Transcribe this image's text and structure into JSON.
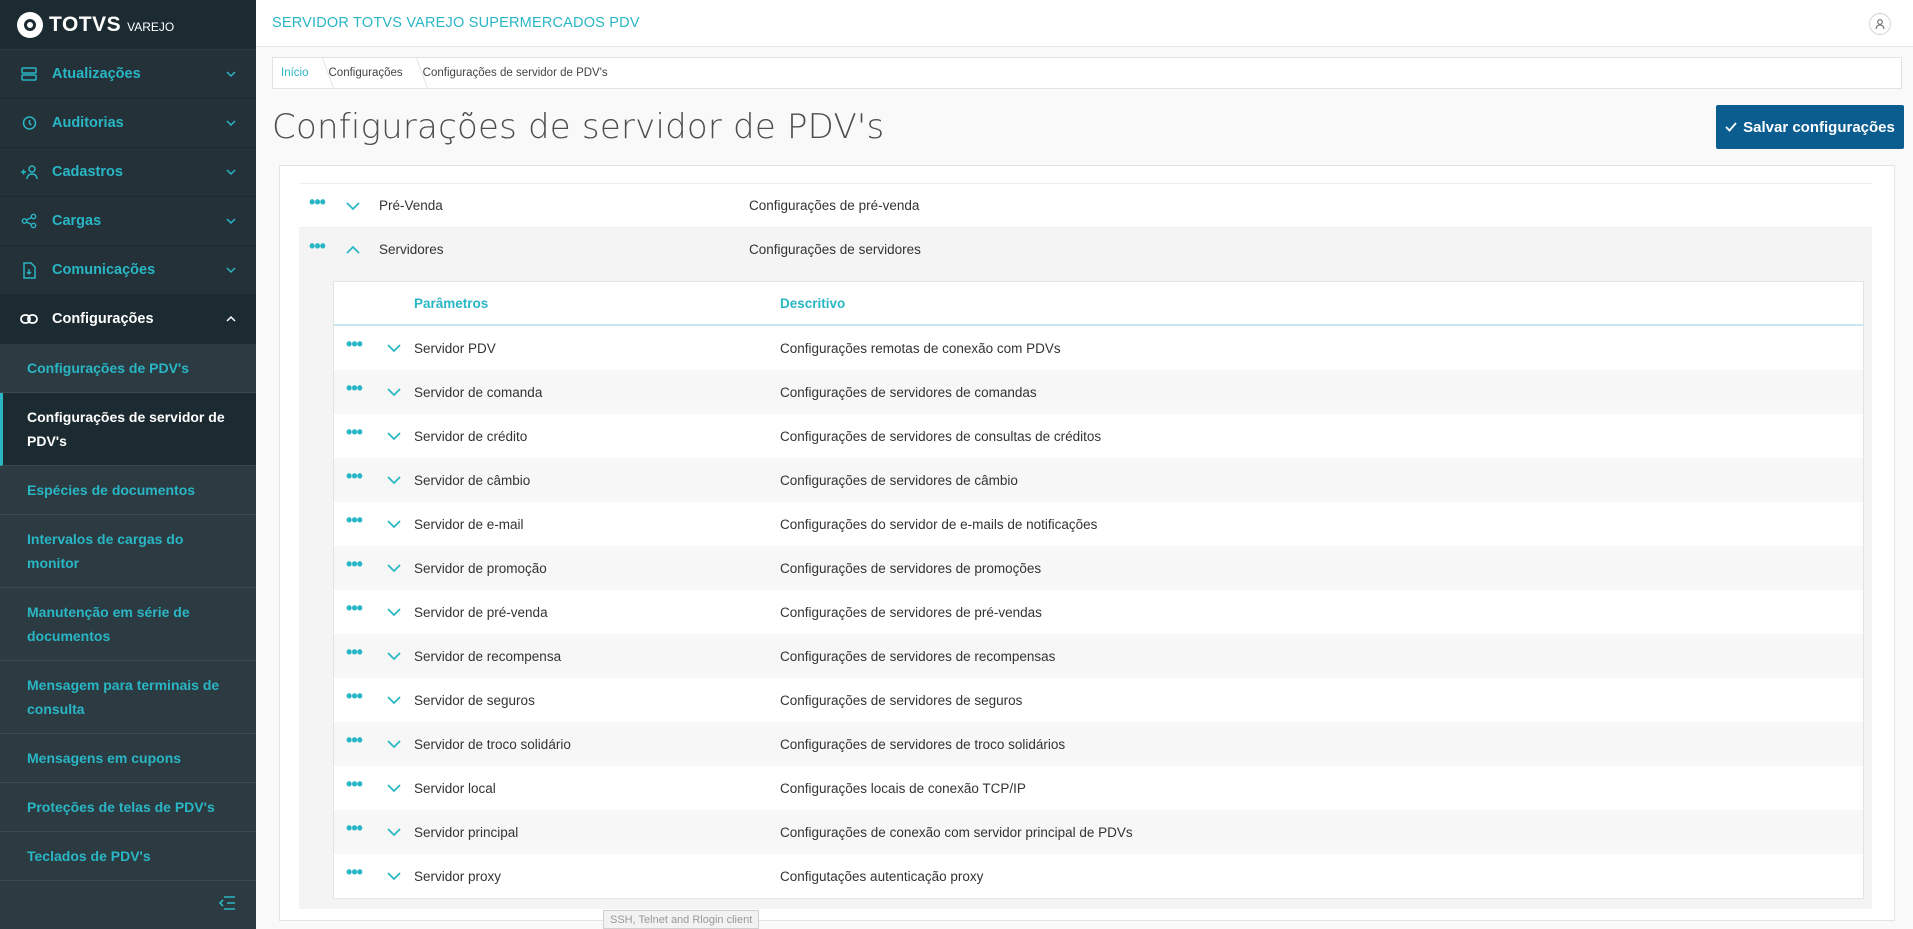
{
  "brand": {
    "name": "TOTVS",
    "sub": "VAREJO"
  },
  "sidebar": {
    "menu": [
      {
        "label": "Atualizações",
        "icon": "server-icon"
      },
      {
        "label": "Auditorias",
        "icon": "history-icon"
      },
      {
        "label": "Cadastros",
        "icon": "add-user-icon"
      },
      {
        "label": "Cargas",
        "icon": "share-icon"
      },
      {
        "label": "Comunicações",
        "icon": "document-sync-icon"
      },
      {
        "label": "Configurações",
        "icon": "link-icon"
      }
    ],
    "submenu": [
      "Configurações de PDV's",
      "Configurações de servidor de PDV's",
      "Espécies de documentos",
      "Intervalos de cargas do monitor",
      "Manutenção em série de documentos",
      "Mensagem para terminais de consulta",
      "Mensagens em cupons",
      "Proteções de telas de PDV's",
      "Teclados de PDV's"
    ]
  },
  "header": {
    "title": "SERVIDOR TOTVS VAREJO SUPERMERCADOS PDV"
  },
  "breadcrumb": [
    "Início",
    "Configurações",
    "Configurações de servidor de PDV's"
  ],
  "page": {
    "title": "Configurações de servidor de PDV's",
    "save_label": "Salvar configurações"
  },
  "outer_rows": [
    {
      "name": "Pré-Venda",
      "desc": "Configurações de pré-venda"
    },
    {
      "name": "Servidores",
      "desc": "Configurações de servidores"
    }
  ],
  "inner_table": {
    "headers": {
      "param": "Parâmetros",
      "desc": "Descritivo"
    },
    "rows": [
      {
        "param": "Servidor PDV",
        "desc": "Configurações remotas de conexão com PDVs"
      },
      {
        "param": "Servidor de comanda",
        "desc": "Configurações de servidores de comandas"
      },
      {
        "param": "Servidor de crédito",
        "desc": "Configurações de servidores de consultas de créditos"
      },
      {
        "param": "Servidor de câmbio",
        "desc": "Configurações de servidores de câmbio"
      },
      {
        "param": "Servidor de e-mail",
        "desc": "Configurações do servidor de e-mails de notificações"
      },
      {
        "param": "Servidor de promoção",
        "desc": "Configurações de servidores de promoções"
      },
      {
        "param": "Servidor de pré-venda",
        "desc": "Configurações de servidores de pré-vendas"
      },
      {
        "param": "Servidor de recompensa",
        "desc": "Configurações de servidores de recompensas"
      },
      {
        "param": "Servidor de seguros",
        "desc": "Configurações de servidores de seguros"
      },
      {
        "param": "Servidor de troco solidário",
        "desc": "Configurações de servidores de troco solidários"
      },
      {
        "param": "Servidor local",
        "desc": "Configurações locais de conexão TCP/IP"
      },
      {
        "param": "Servidor principal",
        "desc": "Configurações de conexão com servidor principal de PDVs"
      },
      {
        "param": "Servidor proxy",
        "desc": "Configutações autenticação proxy"
      }
    ]
  },
  "tooltip": "SSH, Telnet and Rlogin client",
  "colors": {
    "accent": "#29b6c5",
    "primary_button": "#0b5d8f",
    "sidebar": "#1c2a31"
  }
}
